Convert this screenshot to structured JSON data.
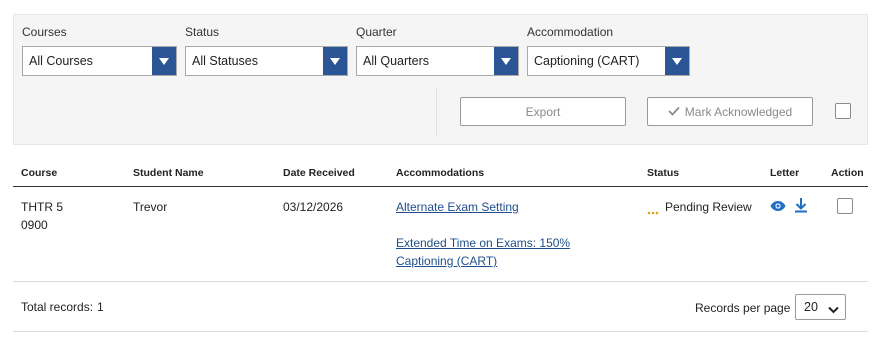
{
  "filters": {
    "courses": {
      "label": "Courses",
      "value": "All Courses"
    },
    "status": {
      "label": "Status",
      "value": "All Statuses"
    },
    "quarter": {
      "label": "Quarter",
      "value": "All Quarters"
    },
    "accommodation": {
      "label": "Accommodation",
      "value": "Captioning (CART)"
    }
  },
  "actions": {
    "export_label": "Export",
    "acknowledge_label": "Mark Acknowledged"
  },
  "table": {
    "headers": [
      "Course",
      "Student Name",
      "Date Received",
      "Accommodations",
      "Status",
      "Letter",
      "Action"
    ],
    "rows": [
      {
        "course_line1": "THTR 5",
        "course_line2": "0900",
        "student": "Trevor",
        "date_received": "03/12/2026",
        "accommodations": [
          "Alternate Exam Setting",
          "Extended Time on Exams: 150%",
          "Captioning (CART)"
        ],
        "status": "Pending Review",
        "status_color": "#e0a21a"
      }
    ]
  },
  "footer": {
    "total_label": "Total records:",
    "total_value": "1",
    "per_page_label": "Records per page",
    "per_page_value": "20"
  },
  "colors": {
    "accent": "#2c5596",
    "link": "#1f4e8c"
  },
  "icons": {
    "dropdown": "chevron-down-icon",
    "check": "check-icon",
    "view": "eye-icon",
    "download": "download-icon",
    "pending": "dots-icon"
  }
}
